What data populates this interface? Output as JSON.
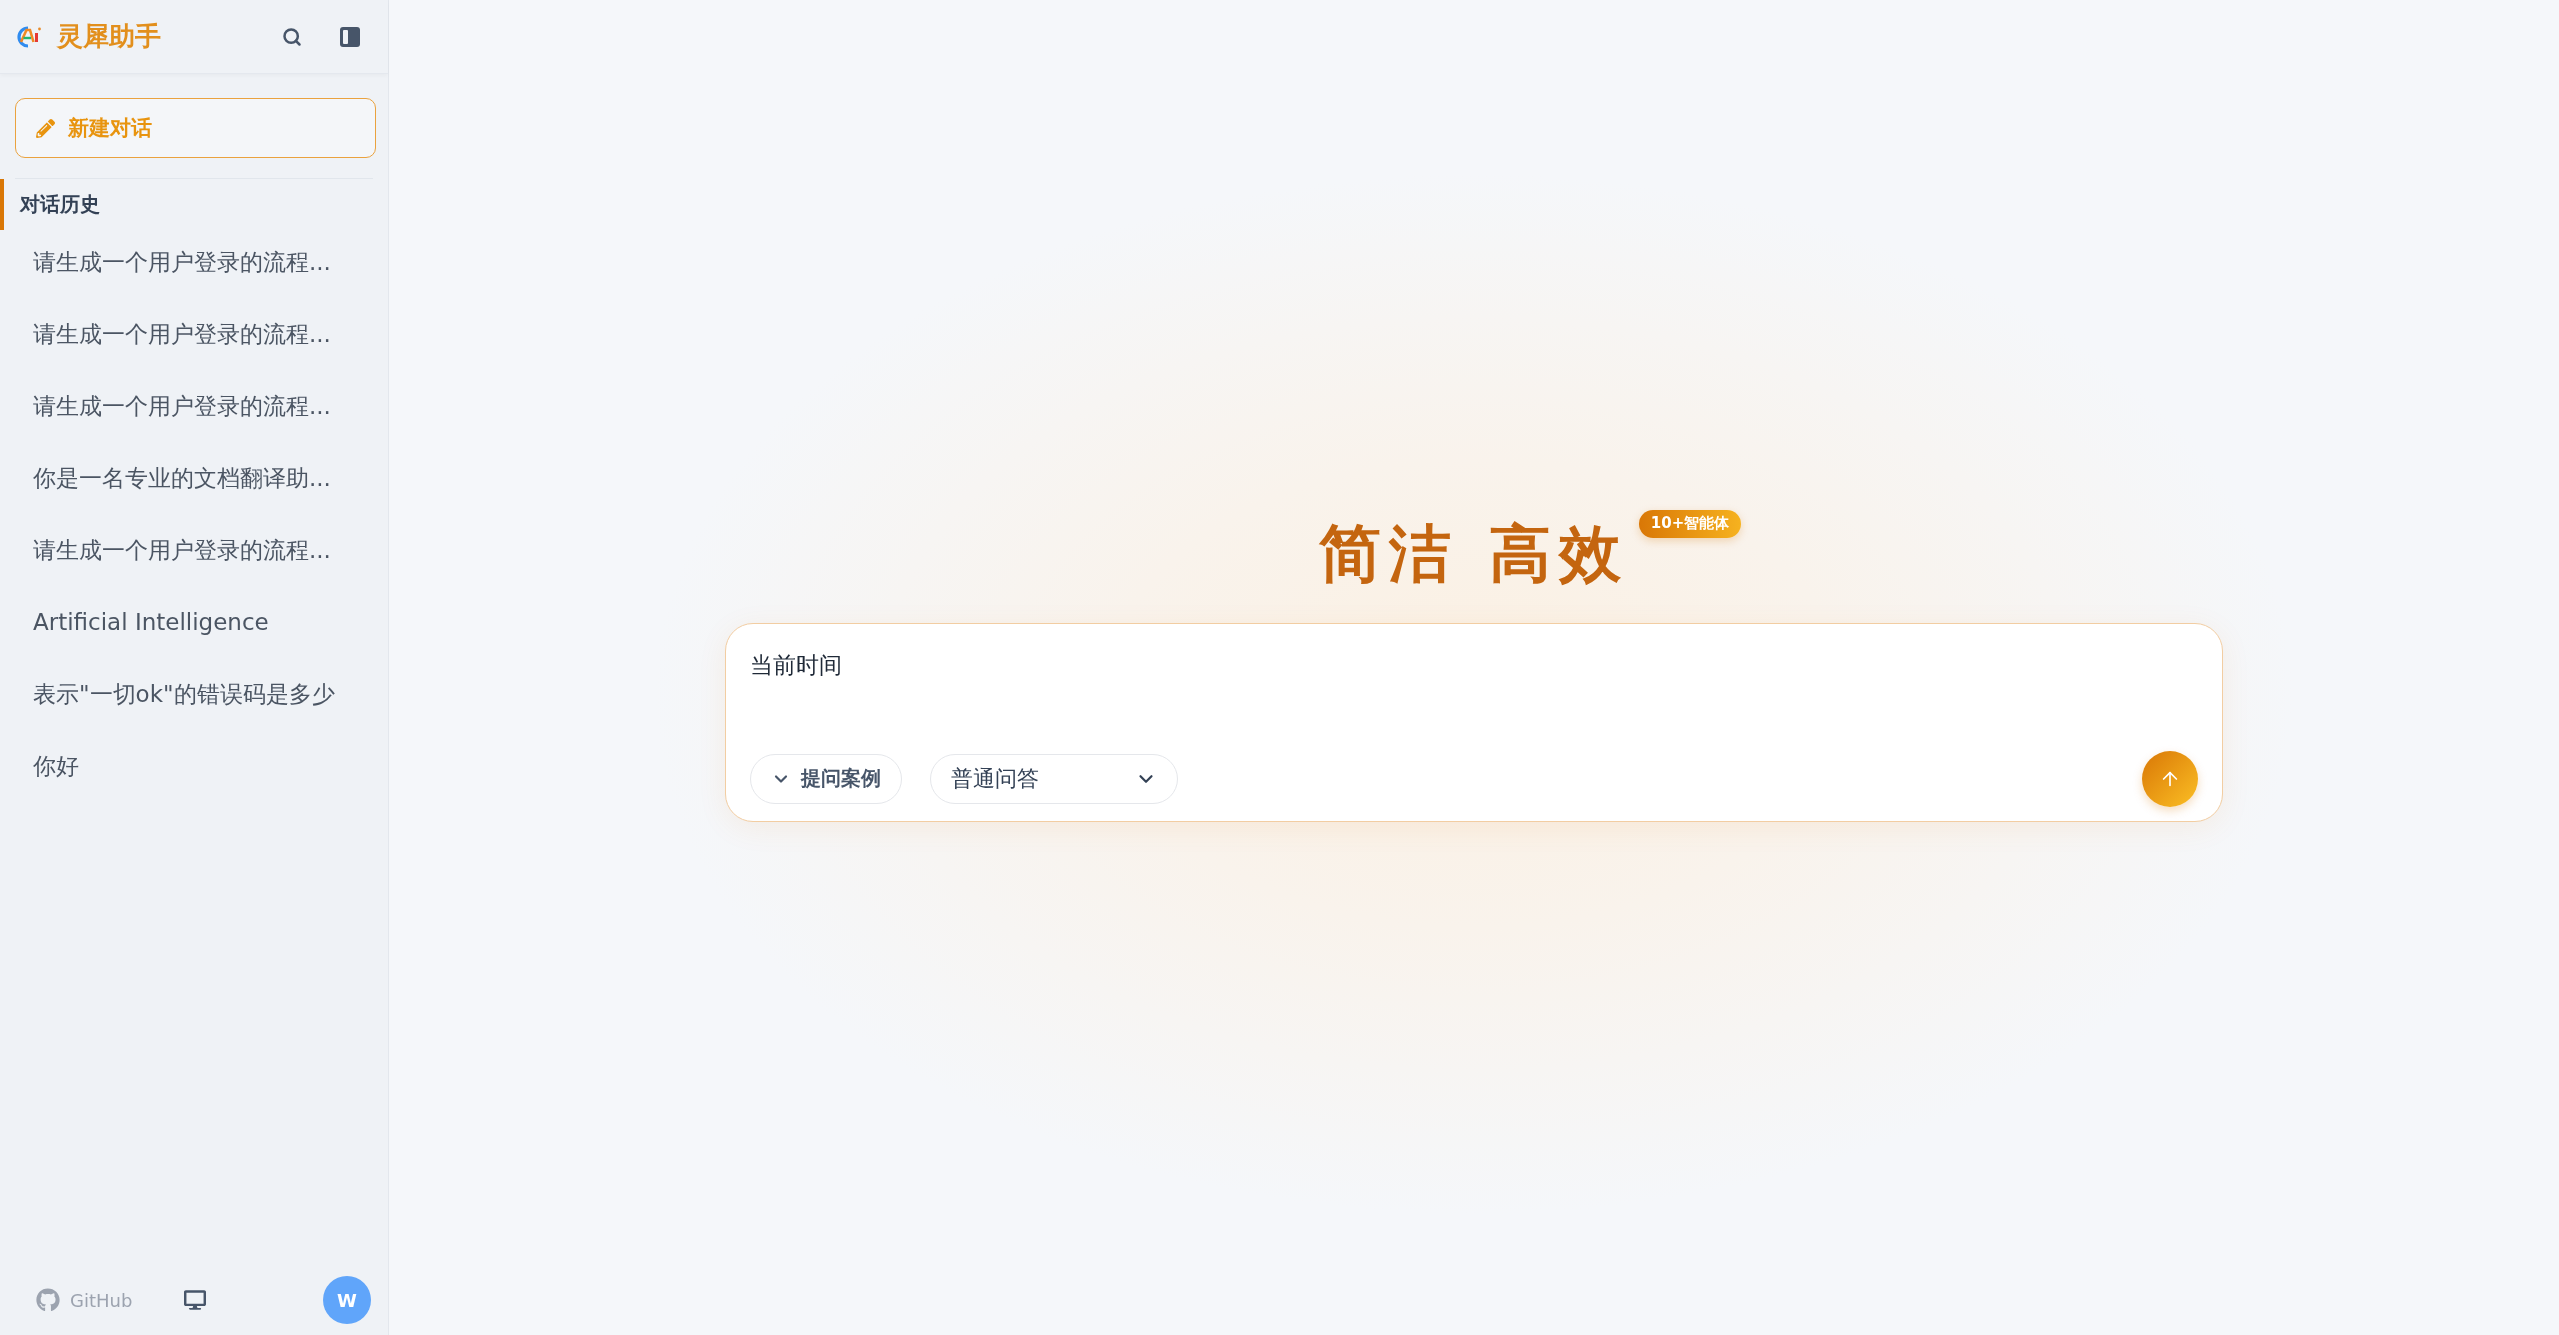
{
  "sidebar": {
    "brand": {
      "title": "灵犀助手"
    },
    "new_chat_button": "新建对话",
    "history": {
      "title": "对话历史",
      "items": [
        "请生成一个用户登录的流程...",
        "请生成一个用户登录的流程...",
        "请生成一个用户登录的流程...",
        "你是一名专业的文档翻译助...",
        "请生成一个用户登录的流程...",
        "Artificial Intelligence",
        "表示\"一切ok\"的错误码是多少",
        "你好"
      ]
    },
    "footer": {
      "github_link": "GitHub",
      "avatar": "W"
    }
  },
  "main": {
    "title": "简洁 高效",
    "badge": "10+智能体",
    "composer": {
      "input": {
        "value": "当前时间"
      },
      "examples_button": "提问案例",
      "mode_select": {
        "value": "普通问答"
      }
    }
  }
}
